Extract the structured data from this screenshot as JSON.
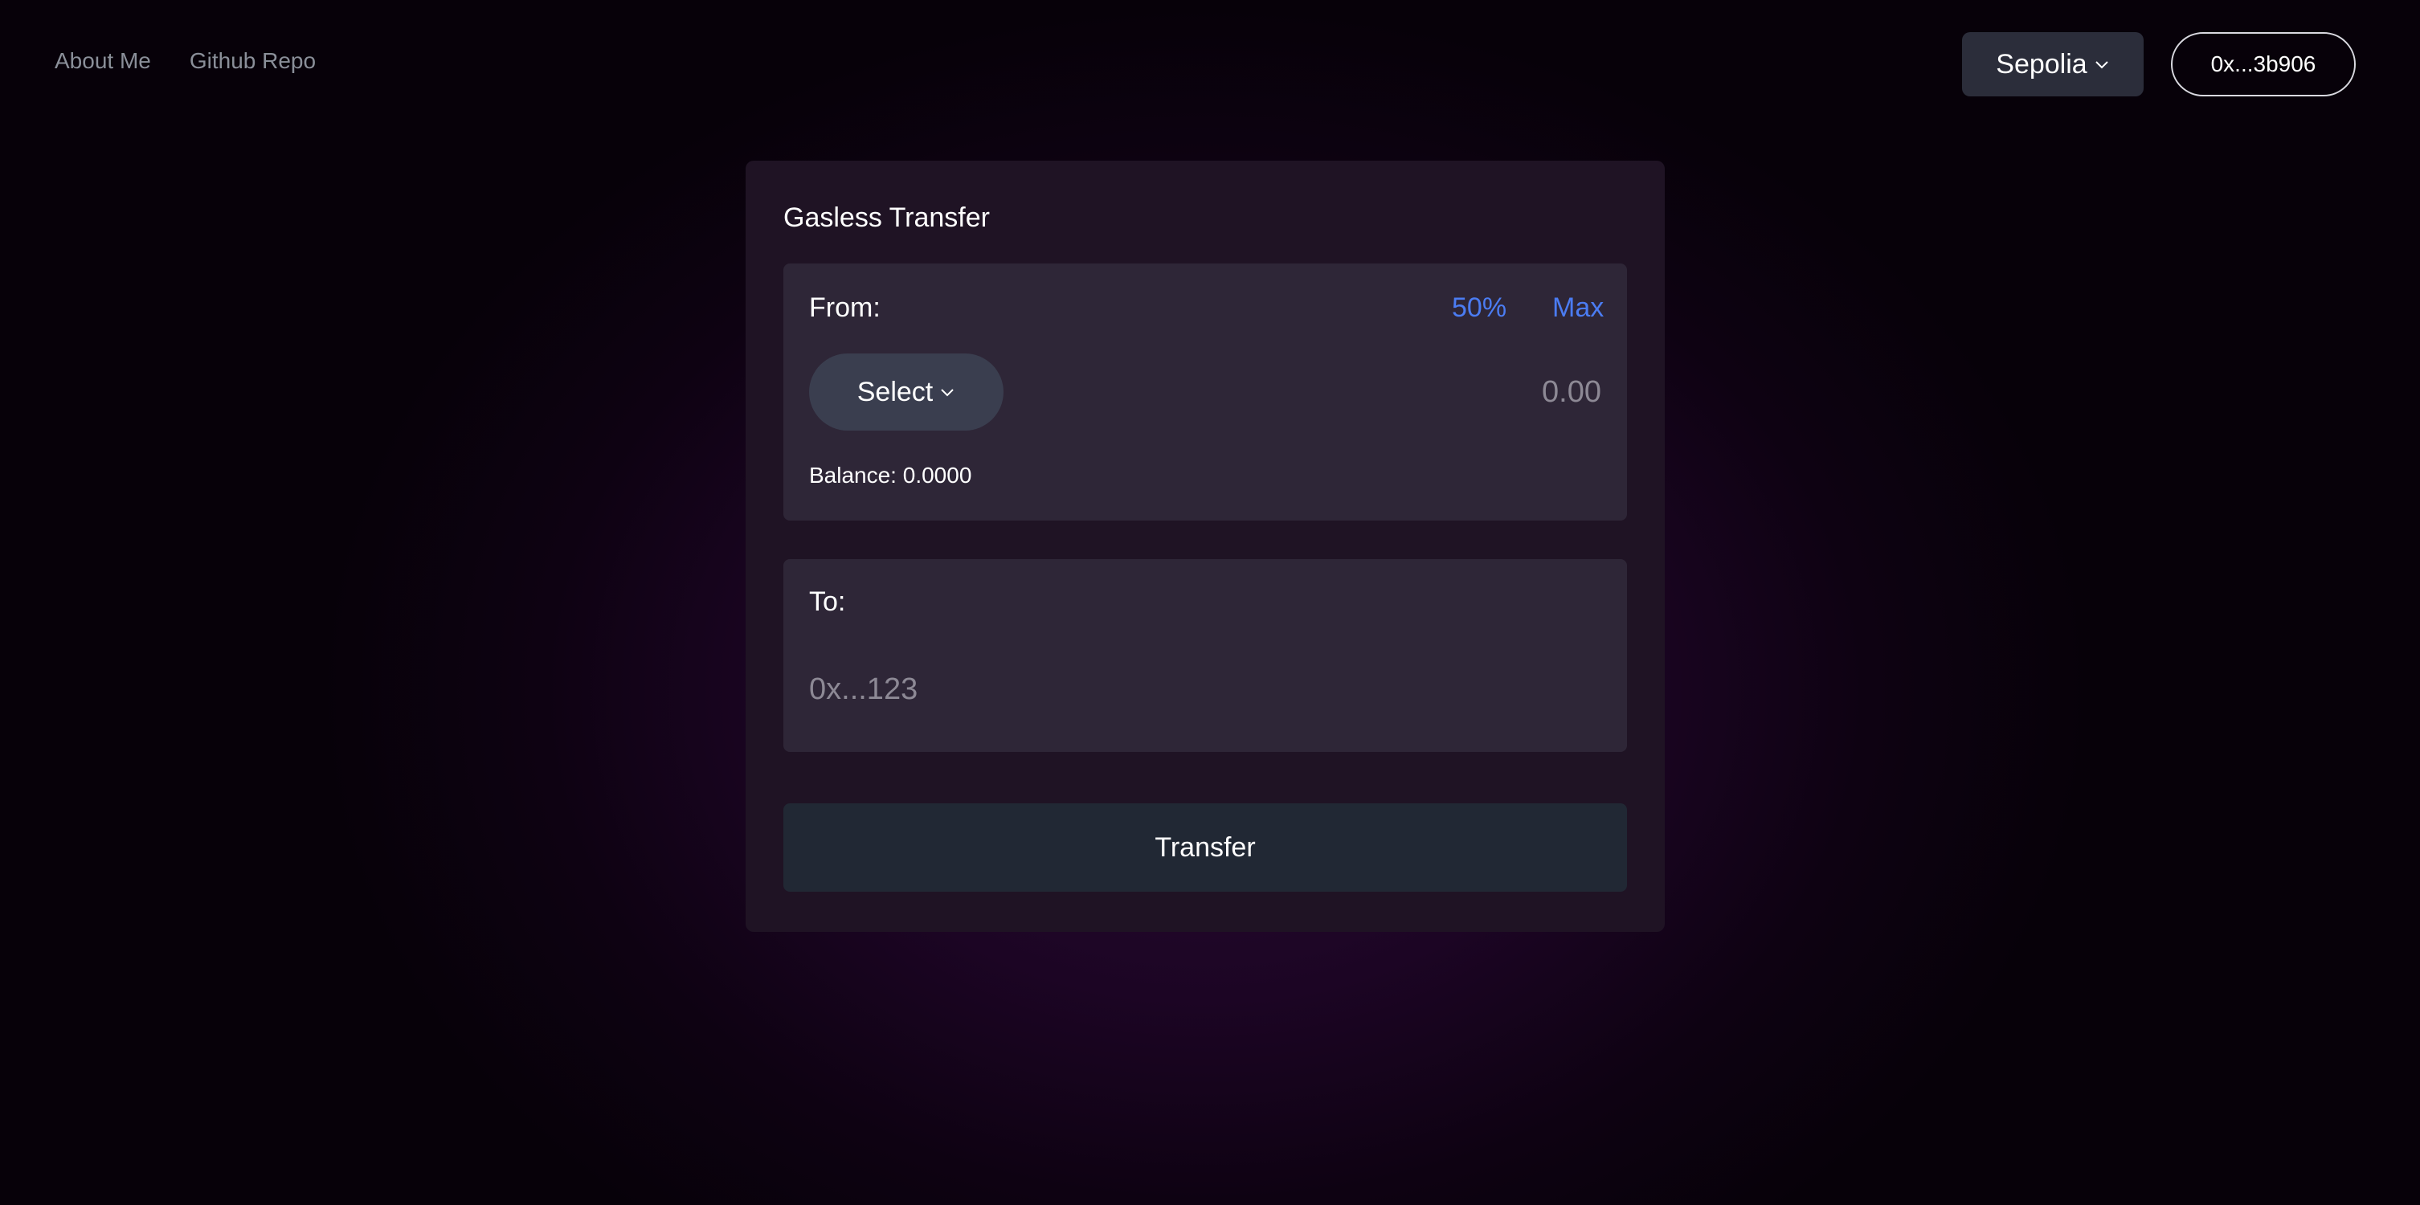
{
  "nav": {
    "about_label": "About Me",
    "github_label": "Github Repo"
  },
  "header": {
    "network_label": "Sepolia",
    "wallet_label": "0x...3b906"
  },
  "card": {
    "title": "Gasless Transfer",
    "from": {
      "label": "From:",
      "half_label": "50%",
      "max_label": "Max",
      "select_label": "Select",
      "amount_placeholder": "0.00",
      "balance_text": "Balance: 0.0000"
    },
    "to": {
      "label": "To:",
      "address_placeholder": "0x...123"
    },
    "transfer_label": "Transfer"
  },
  "colors": {
    "accent": "#4b7cf2",
    "card_bg": "#1f1324",
    "panel_bg": "#2e2637",
    "button_bg": "#212834"
  },
  "icons": {
    "dropdown": "chevron-down-icon"
  }
}
